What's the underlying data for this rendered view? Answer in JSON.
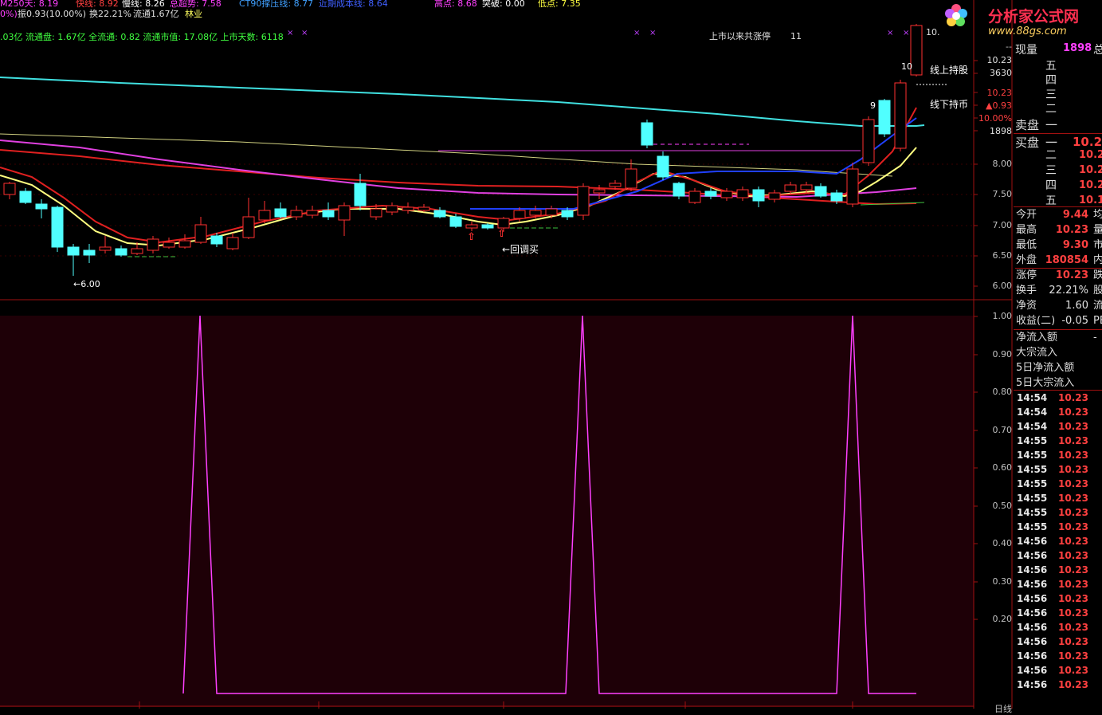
{
  "header": {
    "line1": [
      {
        "text": "M250天: 8.19",
        "color": "#ff40ff"
      },
      {
        "text": "快线: 8.92",
        "color": "#ff4040"
      },
      {
        "text": "慢线: 8.26",
        "color": "#ffffff"
      },
      {
        "text": "总超势: 7.58",
        "color": "#ff40ff"
      },
      {
        "text": "CT90撑压线: 8.77",
        "color": "#40a0ff"
      },
      {
        "text": "近期成本线: 8.64",
        "color": "#4060ff"
      },
      {
        "text": "高点: 8.68",
        "color": "#ff40ff"
      },
      {
        "text": "突破: 0.00",
        "color": "#ffffff"
      },
      {
        "text": "低点: 7.35",
        "color": "#ffff40"
      }
    ],
    "line2": [
      {
        "text": "0%)",
        "color": "#ff40ff"
      },
      {
        "text": "振0.93(10.00%)",
        "color": "#e0e0e0"
      },
      {
        "text": "换22.21%",
        "color": "#e0e0e0"
      },
      {
        "text": "流通1.67亿",
        "color": "#e0e0e0"
      },
      {
        "text": "林业",
        "color": "#ffff60"
      }
    ],
    "line3": ".03亿 流通盘: 1.67亿 全流通: 0.82 流通市值: 17.08亿 上市天数: 6118",
    "limit_up_label": "上市以来共涨停",
    "limit_up_count": "11",
    "top_price": "10.",
    "logo_text": "分析家公式网",
    "logo_url": "www.88gs.com"
  },
  "annotations": {
    "hold_stock": "线上持股",
    "hold_cash": "线下持币",
    "pullback_buy": "←回调买",
    "low_marker": "←6.00",
    "nine": "9",
    "ten": "10"
  },
  "axis_main": [
    "10.23",
    "3630",
    "10.23",
    "▲0.93",
    "10.00%",
    "1898",
    "8.00",
    "7.50",
    "7.00",
    "6.50",
    "6.00"
  ],
  "axis_main_colors": [
    "#e0e0e0",
    "#e0e0e0",
    "#ff4040",
    "#ff4040",
    "#ff4040",
    "#e0e0e0",
    "#c0c0c0",
    "#c0c0c0",
    "#c0c0c0",
    "#c0c0c0",
    "#c0c0c0"
  ],
  "axis_main_top": "--",
  "axis_sub": [
    "1.00",
    "0.90",
    "0.80",
    "0.70",
    "0.60",
    "0.50",
    "0.40",
    "0.30",
    "0.20"
  ],
  "axis_sub_bottom": "日线",
  "quote": {
    "volume_now_label": "现量",
    "volume_now": "1898",
    "volume_now_tail": "总",
    "sell_levels": [
      "五",
      "四",
      "三",
      "二"
    ],
    "sell_label": "卖盘",
    "sell_level1": "一",
    "buy_label": "买盘",
    "buy_level1": "一",
    "buy_level1_price": "10.2",
    "buy_levels": [
      {
        "name": "二",
        "price": "10.2"
      },
      {
        "name": "三",
        "price": "10.2"
      },
      {
        "name": "四",
        "price": "10.2"
      },
      {
        "name": "五",
        "price": "10.1"
      }
    ],
    "stats": [
      {
        "k": "今开",
        "v": "9.44",
        "c": "均",
        "white": false
      },
      {
        "k": "最高",
        "v": "10.23",
        "c": "量",
        "white": false
      },
      {
        "k": "最低",
        "v": "9.30",
        "c": "市",
        "white": false
      },
      {
        "k": "外盘",
        "v": "180854",
        "c": "内",
        "white": false
      },
      {
        "k": "涨停",
        "v": "10.23",
        "c": "跌",
        "white": false
      },
      {
        "k": "换手",
        "v": "22.21%",
        "c": "股",
        "white": true
      },
      {
        "k": "净资",
        "v": "1.60",
        "c": "流",
        "white": true
      },
      {
        "k": "收益(二)",
        "v": "-0.05",
        "c": "PE",
        "white": true
      }
    ],
    "flow": [
      {
        "k": "净流入额",
        "c": "-"
      },
      {
        "k": "大宗流入",
        "c": ""
      },
      {
        "k": "5日净流入额",
        "c": ""
      },
      {
        "k": "5日大宗流入",
        "c": ""
      }
    ],
    "ticks": [
      {
        "t": "14:54",
        "p": "10.23"
      },
      {
        "t": "14:54",
        "p": "10.23"
      },
      {
        "t": "14:54",
        "p": "10.23"
      },
      {
        "t": "14:55",
        "p": "10.23"
      },
      {
        "t": "14:55",
        "p": "10.23"
      },
      {
        "t": "14:55",
        "p": "10.23"
      },
      {
        "t": "14:55",
        "p": "10.23"
      },
      {
        "t": "14:55",
        "p": "10.23"
      },
      {
        "t": "14:55",
        "p": "10.23"
      },
      {
        "t": "14:55",
        "p": "10.23"
      },
      {
        "t": "14:56",
        "p": "10.23"
      },
      {
        "t": "14:56",
        "p": "10.23"
      },
      {
        "t": "14:56",
        "p": "10.23"
      },
      {
        "t": "14:56",
        "p": "10.23"
      },
      {
        "t": "14:56",
        "p": "10.23"
      },
      {
        "t": "14:56",
        "p": "10.23"
      },
      {
        "t": "14:56",
        "p": "10.23"
      },
      {
        "t": "14:56",
        "p": "10.23"
      },
      {
        "t": "14:56",
        "p": "10.23"
      },
      {
        "t": "14:56",
        "p": "10.23"
      },
      {
        "t": "14:56",
        "p": "10.23"
      }
    ]
  },
  "colors": {
    "up": "#ff3030",
    "down": "#50ffff",
    "ma_cyan": "#40e0e0",
    "ma_red": "#e02020",
    "ma_magenta": "#e040e0",
    "ma_yellow": "#ffff80",
    "ma_blue": "#2040ff",
    "signal": "#ff40ff",
    "sub_bg": "#200008",
    "border": "#a01010"
  }
}
